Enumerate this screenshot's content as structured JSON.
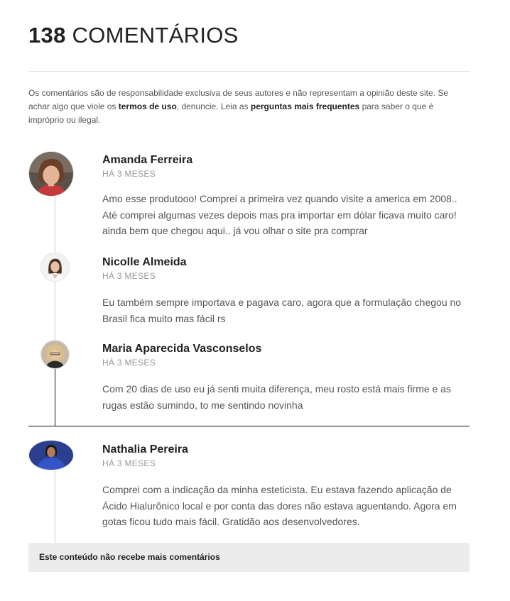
{
  "header": {
    "count": "138",
    "title_word": "COMENTÁRIOS"
  },
  "disclaimer": {
    "part1": "Os comentários são de responsabilidade exclusiva de seus autores e não representam a opinião deste site. Se achar algo que viole os ",
    "link1": "termos de uso",
    "part2": ", denuncie. Leia as ",
    "link2": "perguntas mais frequentes",
    "part3": " para saber o que é impróprio ou ilegal."
  },
  "comments": [
    {
      "author": "Amanda Ferreira",
      "date": "HÁ 3 MESES",
      "text": "Amo esse produtooo! Comprei a primeira vez quando visite a america em 2008.. Até comprei algumas vezes depois mas pra importar em dólar ficava muito caro! ainda bem que chegou aqui.. já vou olhar o site pra comprar",
      "avatar_icon": "woman-photo-avatar"
    },
    {
      "author": "Nicolle Almeida",
      "date": "HÁ 3 MESES",
      "text": "Eu também sempre importava e pagava caro, agora que a formulação chegou no Brasil fica muito mas fácil rs",
      "avatar_icon": "woman-photo-avatar"
    },
    {
      "author": "Maria Aparecida Vasconselos",
      "date": "HÁ 3 MESES",
      "text": "Com 20 dias de uso eu já senti muita diferença, meu rosto está mais firme e as rugas estão sumindo, to me sentindo novinha",
      "avatar_icon": "woman-photo-avatar"
    },
    {
      "author": "Nathalia Pereira",
      "date": "HÁ 3 MESES",
      "text": "Comprei com a indicação da minha esteticista. Eu estava fazendo aplicação de Ácido Hialurônico local e por conta das dores não estava aguentando. Agora em gotas ficou tudo mais fácil. Gratidão aos desenvolvedores.",
      "avatar_icon": "woman-photo-avatar"
    }
  ],
  "footer": {
    "closed_notice": "Este conteúdo não recebe mais comentários"
  },
  "colors": {
    "thread_line": "#cfcfcf",
    "thread_line_active": "#111111",
    "closed_bg": "#ececec"
  }
}
